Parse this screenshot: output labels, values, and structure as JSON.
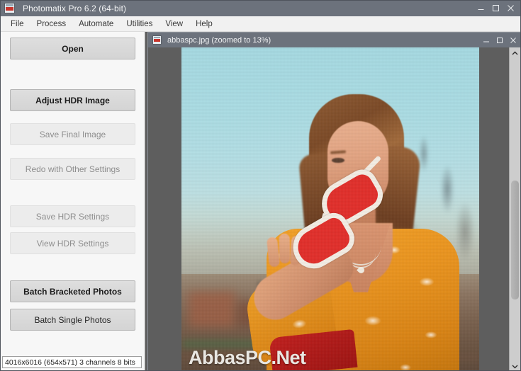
{
  "window": {
    "title": "Photomatix Pro 6.2 (64-bit)",
    "icon": "photomatix-app-icon",
    "controls": {
      "minimize": "minimize-icon",
      "maximize": "maximize-icon",
      "close": "close-icon"
    }
  },
  "menubar": {
    "items": [
      {
        "label": "File"
      },
      {
        "label": "Process"
      },
      {
        "label": "Automate"
      },
      {
        "label": "Utilities"
      },
      {
        "label": "View"
      },
      {
        "label": "Help"
      }
    ]
  },
  "sidebar": {
    "buttons": [
      {
        "label": "Open",
        "state": "enabled",
        "emphasis": "bold"
      },
      {
        "label": "Adjust HDR Image",
        "state": "enabled",
        "emphasis": "bold"
      },
      {
        "label": "Save Final Image",
        "state": "disabled",
        "emphasis": "normal"
      },
      {
        "label": "Redo with Other Settings",
        "state": "disabled",
        "emphasis": "normal"
      },
      {
        "label": "Save HDR Settings",
        "state": "disabled",
        "emphasis": "normal"
      },
      {
        "label": "View HDR Settings",
        "state": "disabled",
        "emphasis": "normal"
      },
      {
        "label": "Batch Bracketed Photos",
        "state": "enabled",
        "emphasis": "bold"
      },
      {
        "label": "Batch Single Photos",
        "state": "enabled",
        "emphasis": "normal"
      }
    ],
    "status": "4016x6016 (654x571) 3 channels 8 bits"
  },
  "child_window": {
    "title": "abbaspc.jpg (zoomed to 13%)",
    "icon": "photomatix-document-icon",
    "zoom_level": "13%",
    "file_name": "abbaspc.jpg",
    "controls": {
      "minimize": "minimize-icon",
      "maximize": "maximize-icon",
      "close": "close-icon"
    },
    "scrollbar": {
      "up_arrow": "chevron-up-icon",
      "down_arrow": "chevron-down-icon"
    },
    "photo": {
      "watermark": "AbbasPC.Net",
      "description": "Woman in orange floral top holding red cat-eye sunglasses against a pale blue sky"
    }
  },
  "colors": {
    "titlebar": "#6c727c",
    "menubar": "#f1f1f1",
    "sidebar_bg": "#f7f7f7",
    "button_enabled": "#d8d8d8",
    "button_disabled": "#ececec",
    "canvas_bg": "#5e5e5e",
    "accent_red": "#e0302c",
    "accent_orange": "#e8931f",
    "sky_blue": "#aadbe2"
  }
}
